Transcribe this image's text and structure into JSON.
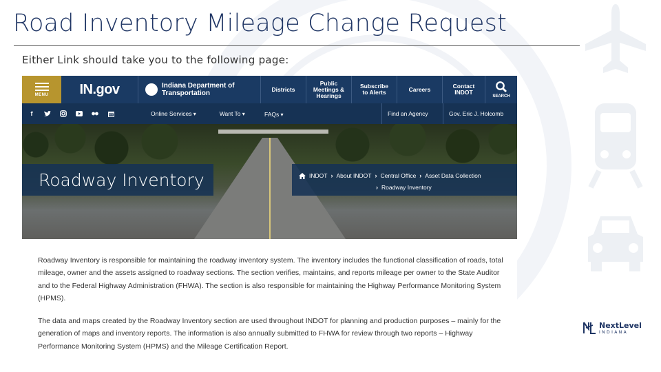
{
  "slide": {
    "title": "Road Inventory Mileage Change Request",
    "subtitle": "Either Link should take you to the following page:",
    "logo_main": "NextLevel",
    "logo_sub": "INDIANA"
  },
  "page": {
    "topbar": {
      "menu_label": "MENU",
      "site_name": "IN.gov",
      "agency": "Indiana Department of\nTransportation",
      "links": [
        "Districts",
        "Public\nMeetings &\nHearings",
        "Subscribe\nto Alerts",
        "Careers",
        "Contact\nINDOT"
      ],
      "search_label": "SEARCH"
    },
    "subbar": {
      "social_icons": [
        "facebook-icon",
        "twitter-icon",
        "instagram-icon",
        "youtube-icon",
        "flickr-icon",
        "calendar-icon"
      ],
      "menus": [
        "Online Services",
        "Want To",
        "FAQs"
      ],
      "buttons": [
        "Find an Agency",
        "Gov. Eric J. Holcomb"
      ]
    },
    "hero": {
      "title": "Roadway Inventory",
      "breadcrumb": [
        "INDOT",
        "About INDOT",
        "Central Office",
        "Asset Data Collection",
        "Roadway Inventory"
      ]
    },
    "body": {
      "paragraph1": "Roadway Inventory is responsible for maintaining the roadway inventory system. The inventory includes the functional classification of roads, total mileage, owner and the assets assigned to roadway sections. The section verifies, maintains, and reports mileage per owner to the State Auditor and to the Federal Highway Administration (FHWA). The section is also responsible for maintaining the Highway Performance Monitoring System (HPMS).",
      "paragraph2": "The data and maps created by the Roadway Inventory section are used throughout INDOT for planning and production purposes – mainly for the generation of maps and inventory reports. The information is also annually submitted to FHWA for review through two reports – Highway Performance Monitoring System (HPMS) and the Mileage Certification Report."
    }
  },
  "colors": {
    "header_navy": "#1a3a63",
    "menu_gold": "#b7952e",
    "title_blue": "#1f3564"
  }
}
